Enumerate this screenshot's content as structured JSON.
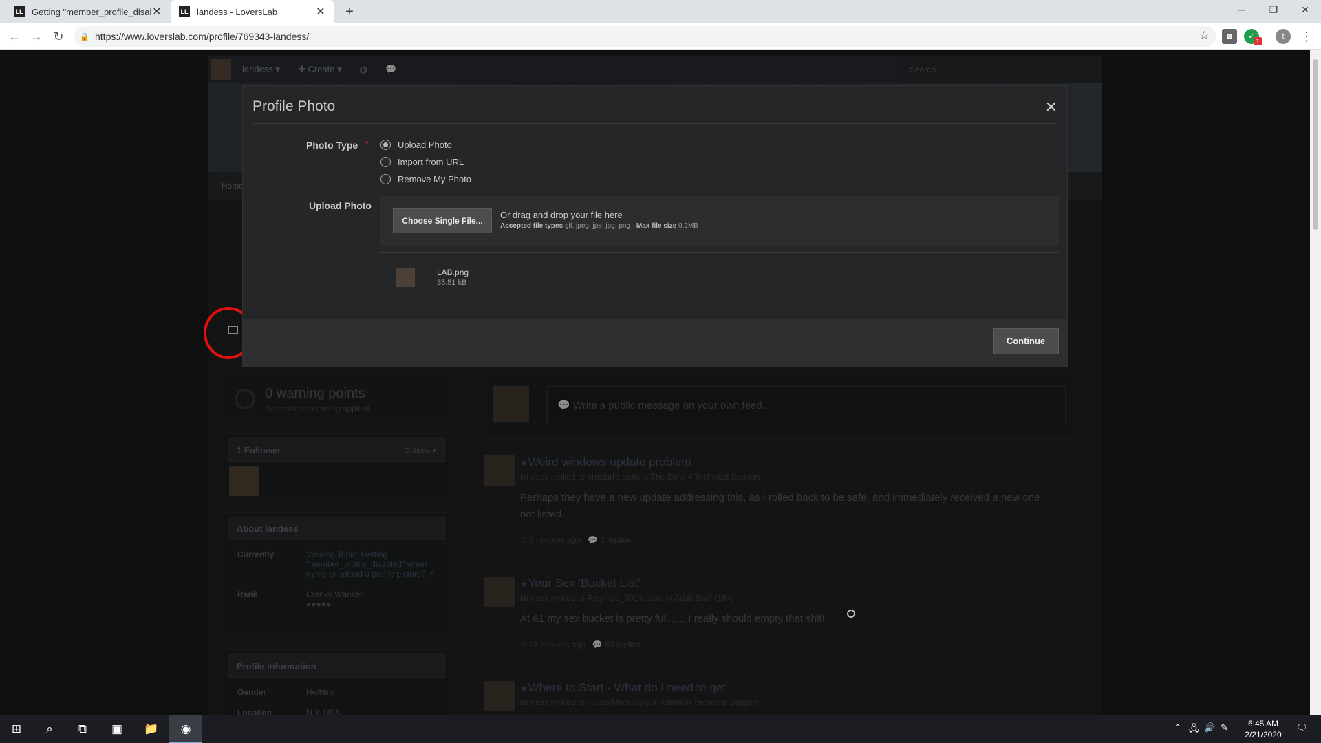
{
  "browser": {
    "tabs": [
      {
        "title": "Getting \"member_profile_disable",
        "favicon": "LL"
      },
      {
        "title": "landess - LoversLab",
        "favicon": "LL"
      }
    ],
    "new_tab": "+",
    "url": "https://www.loverslab.com/profile/769343-landess/",
    "ext_badge": "1",
    "profile_initial": "t"
  },
  "site": {
    "user_menu": "landess ▾",
    "create_menu": "✚ Create ▾",
    "search_placeholder": "Search...",
    "nav_home": "Home"
  },
  "warning": {
    "points": "0 warning points",
    "note": "No restrictions being applied"
  },
  "followers": {
    "title": "1 Follower",
    "options": "Options ▾"
  },
  "about": {
    "title": "About landess",
    "rows": [
      {
        "key": "Currently",
        "value": "Viewing Topic: Getting \"member_profile_disabled\" when trying to upload a profile picture? :/"
      },
      {
        "key": "Rank",
        "value": "Cranky Wanker"
      }
    ],
    "rank_dots": "●●●●●"
  },
  "profile_info": {
    "title": "Profile Information",
    "rows": [
      {
        "key": "Gender",
        "value": "He/Him"
      },
      {
        "key": "Location",
        "value": "N.Y. USA"
      }
    ]
  },
  "composer": {
    "placeholder": "Write a public message on your own feed..."
  },
  "feed": [
    {
      "title": "Weird windows update problem",
      "meta": "landess replied to procian's topic in The Sims 4 Technical Support",
      "body": "Perhaps they have a new update addressing this, as I rolled back to be safe, and immediately received a new one not listed...",
      "time": "5 minutes ago",
      "replies": "7 replies"
    },
    {
      "title": "Your Sex 'Bucket List'",
      "meta": "landess replied to Reginald_001's topic in Adult Stuff (18+)",
      "body": "At 61 my sex bucket is pretty full...... I really should empty that shit!",
      "time": "27 minutes ago",
      "replies": "80 replies"
    },
    {
      "title": "Where to Start - What do I need to get",
      "meta": "landess replied to HunterMix's topic in Oblivion Technical Support"
    }
  ],
  "modal": {
    "title": "Profile Photo",
    "photo_type_label": "Photo Type",
    "required_mark": "*",
    "options": [
      "Upload Photo",
      "Import from URL",
      "Remove My Photo"
    ],
    "selected_option": "Upload Photo",
    "upload_label": "Upload Photo",
    "choose_button": "Choose Single File...",
    "drag_text": "Or drag and drop your file here",
    "accepted_label": "Accepted file types",
    "accepted_types": "gif, jpeg, jpe, jpg, png",
    "max_label": "Max file size",
    "max_size": "0.2MB",
    "file": {
      "name": "LAB.png",
      "size": "35.51 kB"
    },
    "continue_button": "Continue"
  },
  "taskbar": {
    "time": "6:45 AM",
    "date": "2/21/2020"
  },
  "colors": {
    "annotation": "#e01010",
    "modal_bg": "#252627",
    "accent_link": "#4a5a6f"
  }
}
